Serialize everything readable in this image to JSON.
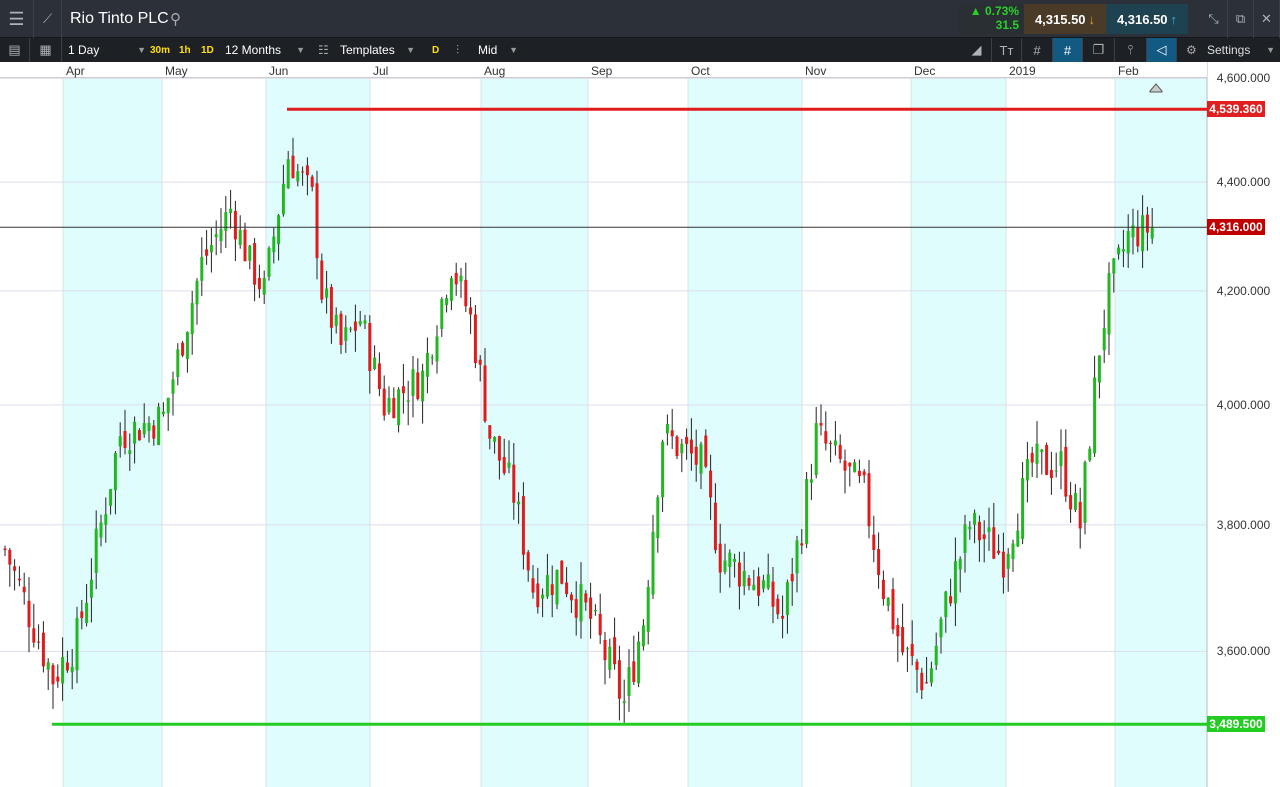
{
  "header": {
    "title": "Rio Tinto PLC",
    "change_pct": "▲ 0.73%",
    "change_abs": "31.5",
    "sell_price": "4,315.50",
    "buy_price": "4,316.50"
  },
  "toolbar": {
    "interval": "1 Day",
    "quick_intervals": [
      "30m",
      "1h",
      "1D"
    ],
    "range": "12 Months",
    "templates": "Templates",
    "d": "D",
    "price_type": "Mid",
    "settings": "Settings"
  },
  "colors": {
    "up": "#22b722",
    "down": "#e01b1b",
    "band": "#e0fdfe",
    "resistance": "#e01b1b",
    "support": "#22cc22"
  },
  "chart_data": {
    "type": "candlestick",
    "x_ticks": [
      "Apr",
      "May",
      "Jun",
      "Jul",
      "Aug",
      "Sep",
      "Oct",
      "Nov",
      "Dec",
      "2019",
      "Feb"
    ],
    "y_ticks": [
      "4,600.000",
      "4,400.000",
      "4,200.000",
      "4,000.000",
      "3,800.000",
      "3,600.000"
    ],
    "y_tick_values": [
      4600,
      4400,
      4200,
      4000,
      3800,
      3600
    ],
    "ylim": [
      3330,
      4640
    ],
    "scale": "log",
    "approx_close_path": [
      [
        0,
        3760
      ],
      [
        4,
        3680
      ],
      [
        10,
        3560
      ],
      [
        15,
        3620
      ],
      [
        20,
        3800
      ],
      [
        24,
        3950
      ],
      [
        33,
        3980
      ],
      [
        41,
        4250
      ],
      [
        47,
        4350
      ],
      [
        51,
        4250
      ],
      [
        54,
        4200
      ],
      [
        59,
        4450
      ],
      [
        64,
        4370
      ],
      [
        66,
        4200
      ],
      [
        70,
        4100
      ],
      [
        74,
        4150
      ],
      [
        79,
        4000
      ],
      [
        87,
        4050
      ],
      [
        93,
        4250
      ],
      [
        97,
        4150
      ],
      [
        101,
        3950
      ],
      [
        106,
        3850
      ],
      [
        110,
        3700
      ],
      [
        116,
        3720
      ],
      [
        122,
        3650
      ],
      [
        129,
        3520
      ],
      [
        133,
        3650
      ],
      [
        137,
        3950
      ],
      [
        145,
        3900
      ],
      [
        149,
        3750
      ],
      [
        158,
        3700
      ],
      [
        162,
        3650
      ],
      [
        166,
        3800
      ],
      [
        169,
        3950
      ],
      [
        174,
        3900
      ],
      [
        179,
        3850
      ],
      [
        183,
        3700
      ],
      [
        187,
        3600
      ],
      [
        192,
        3550
      ],
      [
        197,
        3700
      ],
      [
        201,
        3800
      ],
      [
        208,
        3750
      ],
      [
        214,
        3900
      ],
      [
        220,
        3900
      ],
      [
        224,
        3800
      ],
      [
        226,
        3950
      ],
      [
        228,
        4100
      ],
      [
        230,
        4200
      ],
      [
        234,
        4300
      ],
      [
        239,
        4316
      ]
    ],
    "levels": {
      "resistance": {
        "value": 4539.36,
        "label": "4,539.360"
      },
      "current": {
        "value": 4316,
        "label": "4,316.000"
      },
      "support": {
        "value": 3489.5,
        "label": "3,489.500"
      }
    }
  }
}
